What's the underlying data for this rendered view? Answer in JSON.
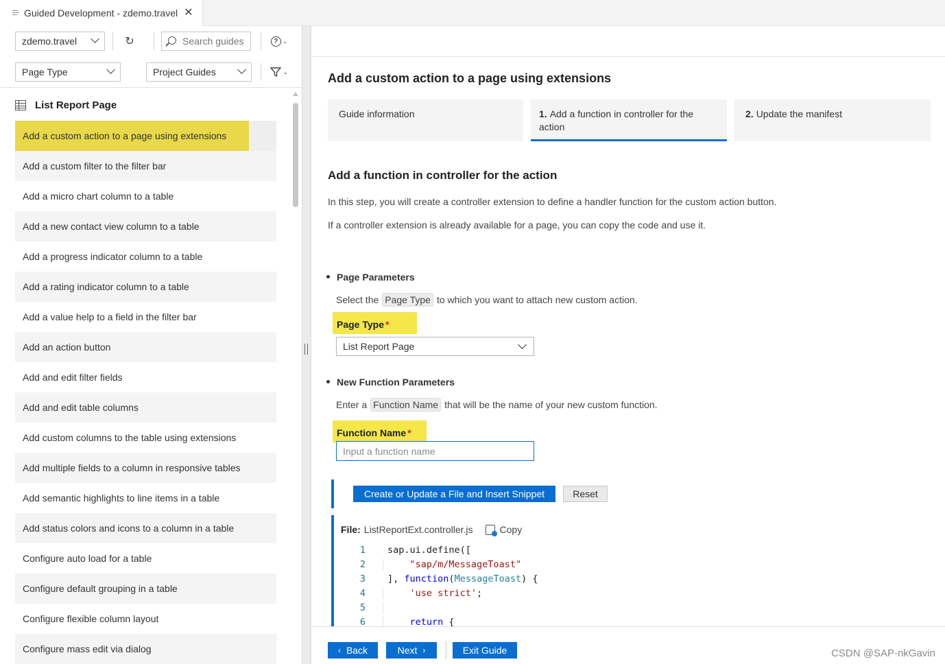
{
  "tab": {
    "title": "Guided Development - zdemo.travel",
    "close": "✕"
  },
  "left": {
    "project_select": "zdemo.travel",
    "refresh_icon": "↻",
    "search_placeholder": "Search guides",
    "help_icon": "?",
    "filter1": "Page Type",
    "filter2": "Project Guides",
    "filter_icon": "funnel-icon",
    "section_title": "List Report Page",
    "guides": [
      "Add a custom action to a page using extensions",
      "Add a custom filter to the filter bar",
      "Add a micro chart column to a table",
      "Add a new contact view column to a table",
      "Add a progress indicator column to a table",
      "Add a rating indicator column to a table",
      "Add a value help to a field in the filter bar",
      "Add an action button",
      "Add and edit filter fields",
      "Add and edit table columns",
      "Add custom columns to the table using extensions",
      "Add multiple fields to a column in responsive tables",
      "Add semantic highlights to line items in a table",
      "Add status colors and icons to a column in a table",
      "Configure auto load for a table",
      "Configure default grouping in a table",
      "Configure flexible column layout",
      "Configure mass edit via dialog"
    ]
  },
  "right": {
    "title": "Add a custom action to a page using extensions",
    "steps": [
      {
        "num": "",
        "label": "Guide information"
      },
      {
        "num": "1.",
        "label": "Add a function in controller for the action"
      },
      {
        "num": "2.",
        "label": "Update the manifest"
      }
    ],
    "section_title": "Add a function in controller for the action",
    "desc1": "In this step, you will create a controller extension to define a handler function for the custom action button.",
    "desc2": "If a controller extension is already available for a page, you can copy the code and use it.",
    "page_params": {
      "heading": "Page Parameters",
      "text_before": "Select the",
      "chip": "Page Type",
      "text_after": "to which you want to attach new custom action.",
      "field_label": "Page Type",
      "required": "*",
      "value": "List Report Page"
    },
    "func_params": {
      "heading": "New Function Parameters",
      "text_before": "Enter a",
      "chip": "Function Name",
      "text_after": "that will be the name of your new custom function.",
      "field_label": "Function Name",
      "required": "*",
      "placeholder": "Input a function name"
    },
    "buttons": {
      "create": "Create or Update a File and Insert Snippet",
      "reset": "Reset"
    },
    "file": {
      "label": "File:",
      "name": "ListReportExt.controller.js",
      "copy": "Copy"
    },
    "code": [
      {
        "n": "1"
      },
      {
        "n": "2"
      },
      {
        "n": "3"
      },
      {
        "n": "4"
      },
      {
        "n": "5"
      },
      {
        "n": "6"
      }
    ],
    "footer": {
      "back": "Back",
      "next": "Next",
      "exit": "Exit Guide"
    }
  },
  "watermark": "CSDN @SAP-nkGavin",
  "colors": {
    "accent": "#0a6ed1",
    "highlight": "#e8d84a",
    "required": "#d0271d"
  }
}
